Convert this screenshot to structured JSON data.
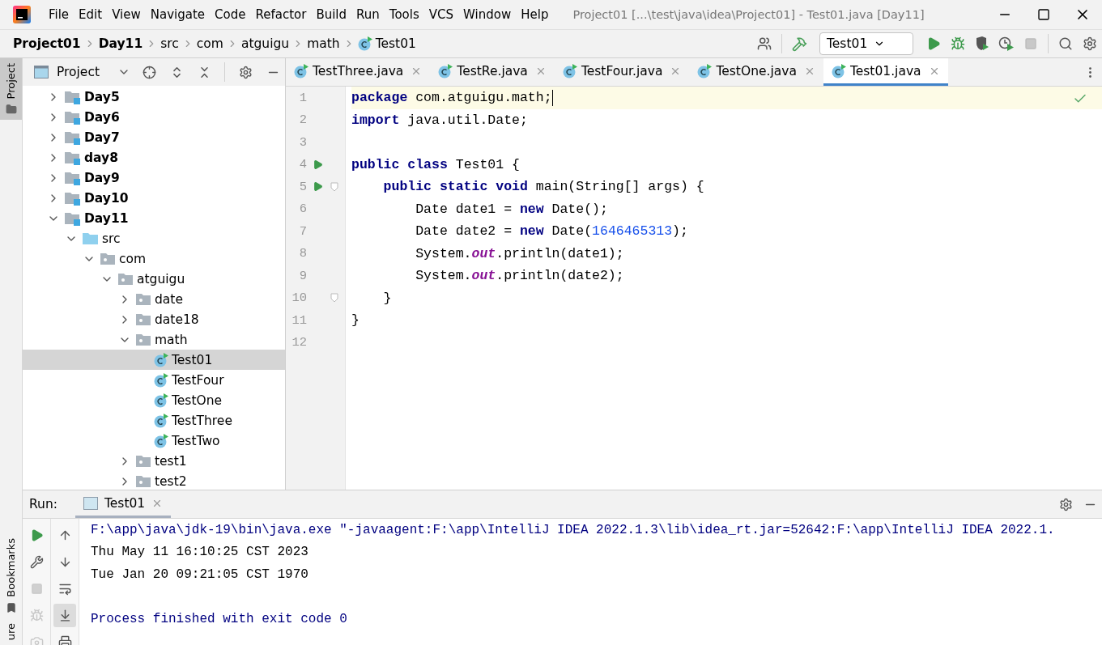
{
  "window": {
    "title": "Project01 [...\\test\\java\\idea\\Project01] - Test01.java [Day11]"
  },
  "menu": [
    "File",
    "Edit",
    "View",
    "Navigate",
    "Code",
    "Refactor",
    "Build",
    "Run",
    "Tools",
    "VCS",
    "Window",
    "Help"
  ],
  "breadcrumbs": [
    {
      "label": "Project01",
      "kind": "project"
    },
    {
      "label": "Day11",
      "kind": "module"
    },
    {
      "label": "src",
      "kind": "folder"
    },
    {
      "label": "com",
      "kind": "folder"
    },
    {
      "label": "atguigu",
      "kind": "folder"
    },
    {
      "label": "math",
      "kind": "folder"
    },
    {
      "label": "Test01",
      "kind": "class"
    }
  ],
  "run_config": {
    "label": "Test01"
  },
  "side_tabs": [
    {
      "label": "Project",
      "selected": true
    },
    {
      "label": "Bookmarks",
      "selected": false
    },
    {
      "label": "ure",
      "selected": false
    }
  ],
  "project_panel": {
    "title": "Project",
    "tree": [
      {
        "label": "Day5",
        "kind": "module",
        "expanded": false,
        "selected": false
      },
      {
        "label": "Day6",
        "kind": "module",
        "expanded": false,
        "selected": false
      },
      {
        "label": "Day7",
        "kind": "module",
        "expanded": false,
        "selected": false
      },
      {
        "label": "day8",
        "kind": "module",
        "expanded": false,
        "selected": false
      },
      {
        "label": "Day9",
        "kind": "module",
        "expanded": false,
        "selected": false
      },
      {
        "label": "Day10",
        "kind": "module",
        "expanded": false,
        "selected": false
      },
      {
        "label": "Day11",
        "kind": "module",
        "expanded": true,
        "selected": false,
        "children": [
          {
            "label": "src",
            "kind": "source",
            "expanded": true,
            "selected": false,
            "children": [
              {
                "label": "com",
                "kind": "package",
                "expanded": true,
                "selected": false,
                "children": [
                  {
                    "label": "atguigu",
                    "kind": "package",
                    "expanded": true,
                    "selected": false,
                    "children": [
                      {
                        "label": "date",
                        "kind": "package",
                        "expanded": false,
                        "selected": false
                      },
                      {
                        "label": "date18",
                        "kind": "package",
                        "expanded": false,
                        "selected": false
                      },
                      {
                        "label": "math",
                        "kind": "package",
                        "expanded": true,
                        "selected": false,
                        "children": [
                          {
                            "label": "Test01",
                            "kind": "class",
                            "selected": true
                          },
                          {
                            "label": "TestFour",
                            "kind": "class",
                            "selected": false
                          },
                          {
                            "label": "TestOne",
                            "kind": "class",
                            "selected": false
                          },
                          {
                            "label": "TestThree",
                            "kind": "class",
                            "selected": false
                          },
                          {
                            "label": "TestTwo",
                            "kind": "class",
                            "selected": false
                          }
                        ]
                      },
                      {
                        "label": "test1",
                        "kind": "package",
                        "expanded": false,
                        "selected": false
                      },
                      {
                        "label": "test2",
                        "kind": "package",
                        "expanded": false,
                        "selected": false
                      }
                    ]
                  }
                ]
              }
            ]
          }
        ]
      }
    ]
  },
  "editor_tabs": [
    {
      "label": "TestThree.java",
      "selected": false
    },
    {
      "label": "TestRe.java",
      "selected": false
    },
    {
      "label": "TestFour.java",
      "selected": false
    },
    {
      "label": "TestOne.java",
      "selected": false
    },
    {
      "label": "Test01.java",
      "selected": true
    }
  ],
  "code_lines": [
    {
      "number": "1",
      "current": true,
      "run_marker": false,
      "fold": false,
      "tokens": [
        {
          "kind": "keyword",
          "text": "package"
        },
        {
          "kind": "plain",
          "text": " com.atguigu.math;"
        }
      ]
    },
    {
      "number": "2",
      "current": false,
      "run_marker": false,
      "fold": false,
      "tokens": [
        {
          "kind": "keyword",
          "text": "import"
        },
        {
          "kind": "plain",
          "text": " java.util.Date;"
        }
      ]
    },
    {
      "number": "3",
      "current": false,
      "run_marker": false,
      "fold": false
    },
    {
      "number": "4",
      "current": false,
      "run_marker": true,
      "fold": false,
      "tokens": [
        {
          "kind": "keyword",
          "text": "public class"
        },
        {
          "kind": "plain",
          "text": " Test01 {"
        }
      ]
    },
    {
      "number": "5",
      "current": false,
      "run_marker": true,
      "fold": true,
      "tokens": [
        {
          "kind": "keyword",
          "text": "    public static void"
        },
        {
          "kind": "plain",
          "text": " main(String[] args) {"
        }
      ]
    },
    {
      "number": "6",
      "current": false,
      "run_marker": false,
      "fold": false,
      "tokens": [
        {
          "kind": "plain",
          "text": "        Date date1 = "
        },
        {
          "kind": "keyword",
          "text": "new"
        },
        {
          "kind": "plain",
          "text": " Date();"
        }
      ]
    },
    {
      "number": "7",
      "current": false,
      "run_marker": false,
      "fold": false,
      "tokens": [
        {
          "kind": "plain",
          "text": "        Date date2 = "
        },
        {
          "kind": "keyword",
          "text": "new"
        },
        {
          "kind": "plain",
          "text": " Date("
        },
        {
          "kind": "number",
          "text": "1646465313"
        },
        {
          "kind": "plain",
          "text": ");"
        }
      ]
    },
    {
      "number": "8",
      "current": false,
      "run_marker": false,
      "fold": false,
      "tokens": [
        {
          "kind": "plain",
          "text": "        System."
        },
        {
          "kind": "field",
          "text": "out"
        },
        {
          "kind": "plain",
          "text": ".println(date1);"
        }
      ]
    },
    {
      "number": "9",
      "current": false,
      "run_marker": false,
      "fold": false,
      "tokens": [
        {
          "kind": "plain",
          "text": "        System."
        },
        {
          "kind": "field",
          "text": "out"
        },
        {
          "kind": "plain",
          "text": ".println(date2);"
        }
      ]
    },
    {
      "number": "10",
      "current": false,
      "run_marker": false,
      "fold": true,
      "tokens": [
        {
          "kind": "plain",
          "text": "    }"
        }
      ]
    },
    {
      "number": "11",
      "current": false,
      "run_marker": false,
      "fold": false,
      "tokens": [
        {
          "kind": "plain",
          "text": "}"
        }
      ]
    },
    {
      "number": "12",
      "current": false,
      "run_marker": false,
      "fold": false
    }
  ],
  "run_panel": {
    "label": "Run:",
    "tab": {
      "label": "Test01",
      "selected": true
    },
    "console": [
      {
        "kind": "command",
        "text": "F:\\app\\java\\jdk-19\\bin\\java.exe \"-javaagent:F:\\app\\IntelliJ IDEA 2022.1.3\\lib\\idea_rt.jar=52642:F:\\app\\IntelliJ IDEA 2022.1."
      },
      {
        "kind": "output",
        "text": "Thu May 11 16:10:25 CST 2023"
      },
      {
        "kind": "output",
        "text": "Tue Jan 20 09:21:05 CST 1970"
      },
      {
        "kind": "exit",
        "text": "Process finished with exit code 0"
      }
    ]
  }
}
